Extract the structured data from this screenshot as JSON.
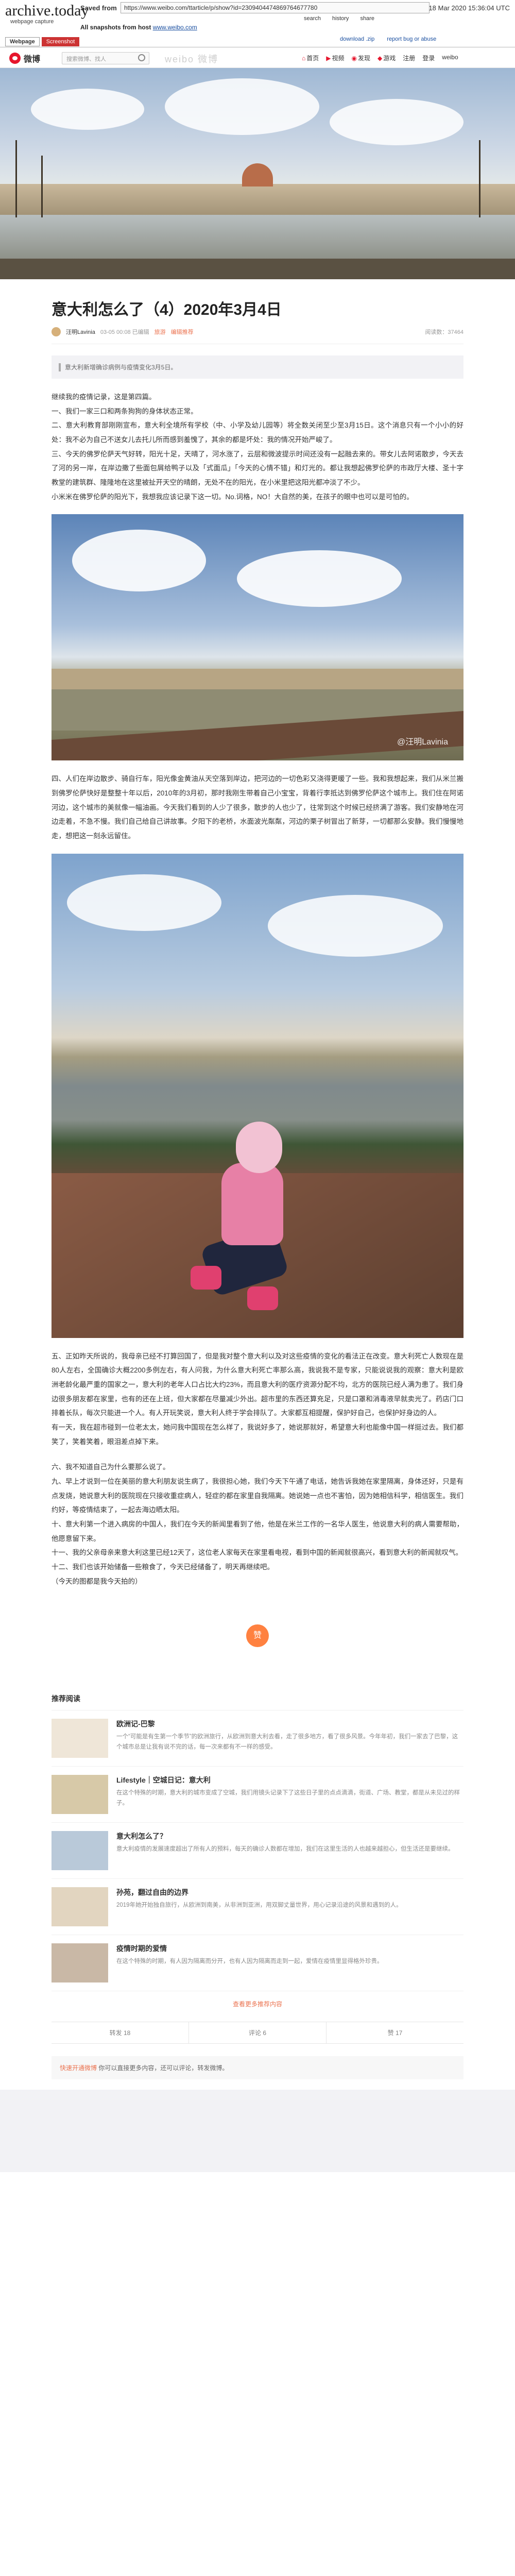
{
  "archive": {
    "logo": "archive.today",
    "subtitle": "webpage capture",
    "saved_from_label": "Saved from",
    "url": "https://www.weibo.com/ttarticle/p/show?id=2309404474869764677780",
    "date": "18 Mar 2020 15:36:04 UTC",
    "all_snapshots": "All snapshots from host",
    "host": "www.weibo.com",
    "tools": [
      "search",
      "history",
      "share"
    ],
    "tools2": [
      "download .zip",
      "report bug or abuse"
    ],
    "tabs": [
      "Webpage",
      "Screenshot"
    ]
  },
  "nav": {
    "logo": "微博",
    "search_placeholder": "搜索微博、找人",
    "watermark": "weibo 微博",
    "menu": [
      "首页",
      "视频",
      "发现",
      "游戏",
      "注册",
      "登录",
      "weibo"
    ]
  },
  "article": {
    "title": "意大利怎么了（4）2020年3月4日",
    "author": "汪明Lavinia",
    "date": "03-05 00:08 已编辑",
    "tag1": "旅游",
    "tag2": "编辑推荐",
    "read": "阅读数：37464",
    "notice": "意大利新增确诊病例与疫情变化3月5日。",
    "p1": "继续我的疫情记录，这是第四篇。\n一、我们一家三口和两条狗狗的身体状态正常。\n二、意大利教育部刚刚宣布，意大利全境所有学校（中、小学及幼儿园等）将全数关闭至少至3月15日。这个消息只有一个小小的好处：我不必为自己不送女儿去托儿所而感到羞愧了，其余的都是坏处：我的情况开始严峻了。\n三、今天的佛罗伦萨天气好转，阳光十足，天晴了，河水涨了，云层和微波提示时间还没有一起融去来的。带女儿去阿诺散步，今天去了河的另一岸，在岸边撒了些面包屑给鸭子以及「式面瓜」「今天的心情不错」和灯光的。都让我想起佛罗伦萨的市政厅大楼、圣十字教堂的建筑群、隆隆地在这里被扯开天空的晴朗，无处不在的阳光，在小米里把这阳光都冲淡了不少。\n小米米在佛罗伦萨的阳光下，我想我应该记录下这一切。No.词格，NO！大自然的美，在孩子的眼中也可以是可怕的。",
    "p2": "四、人们在岸边散步、骑自行车，阳光像金黄油从天空落到岸边，把河边的一切色彩又浇得更暖了一些。我和我想起来，我们从米兰搬到佛罗伦萨快好是整整十年以后，2010年的3月初，那时我刚生带着自己小宝宝，背着行李抵达到佛罗伦萨这个城市上。我们住在阿诺河边，这个城市的美就像一幅油画。今天我们看到的人少了很多，散步的人也少了，往常到这个时候已经挤满了游客。我们安静地在河边走着，不急不慢。我们自己给自己讲故事。夕阳下的老桥，水面波光粼粼，河边的栗子树冒出了新芽，一切都那么安静。我们慢慢地走，想把这一刻永远留住。",
    "p3": "五、正如昨天所说的，我母亲已经不打算回国了，但是我对整个意大利以及对这些疫情的变化的看法正在改变。意大利死亡人数现在是80人左右，全国确诊大概2200多例左右，有人问我，为什么意大利死亡率那么高，我说我不是专家，只能说说我的观察：意大利是欧洲老龄化最严重的国家之一，意大利的老年人口占比大约23%，而且意大利的医疗资源分配不均，北方的医院已经人满为患了。我们身边很多朋友都在家里，也有的还在上班，但大家都在尽量减少外出。超市里的东西还算充足，只是口罩和消毒液早就卖光了。药店门口排着长队，每次只能进一个人。有人开玩笑说，意大利人终于学会排队了。大家都互相提醒，保护好自己，也保护好身边的人。\n有一天，我在超市碰到一位老太太，她问我中国现在怎么样了，我说好多了，她说那就好，希望意大利也能像中国一样挺过去。我们都笑了，笑着笑着，眼泪差点掉下来。",
    "p4": "六、我不知道自己为什么要那么说了。\n九、早上才说到一位在美丽的意大利朋友说生病了，我很担心她，我们今天下午通了电话，她告诉我她在家里隔离，身体还好，只是有点发烧，她说意大利的医院现在只接收重症病人，轻症的都在家里自我隔离。她说她一点也不害怕，因为她相信科学，相信医生。我们约好，等疫情结束了，一起去海边晒太阳。\n十、意大利第一个进入病房的中国人，我们在今天的新闻里看到了他，他是在米兰工作的一名华人医生，他说意大利的病人需要帮助，他愿意留下来。\n十一、我的父亲母亲来意大利这里已经12天了，这位老人家每天在家里看电视，看到中国的新闻就很高兴，看到意大利的新闻就叹气。\n十二、我们也该开始储备一些粮食了，今天已经储备了，明天再继续吧。\n（今天的图都是我今天拍的）",
    "wm1": "@汪明Lavinia",
    "wm2": "@汪明Lavinia"
  },
  "reward": "赞",
  "recommend": {
    "title": "推荐阅读",
    "items": [
      {
        "name": "欧洲记-巴黎",
        "desc": "一个“可能是有生第一个季节”的欧洲旅行，从欧洲到意大利去看，走了很多地方，看了很多风景。今年年初，我们一家去了巴黎，这个城市总是让我有说不完的话，每一次来都有不一样的感受。",
        "thumb": "#efe6d8"
      },
      {
        "name": "Lifestyle｜空城日记：意大利",
        "desc": "在这个特殊的时期，意大利的城市变成了空城，我们用镜头记录下了这些日子里的点点滴滴，街道、广场、教堂，都是从未见过的样子。",
        "thumb": "#d7c9a8"
      },
      {
        "name": "意大利怎么了？",
        "desc": "意大利疫情的发展速度超出了所有人的预料，每天的确诊人数都在增加，我们在这里生活的人也越来越担心，但生活还是要继续。",
        "thumb": "#b9c9d9"
      },
      {
        "name": "孙苑，翻过自由的边界",
        "desc": "2019年她开始独自旅行，从欧洲到南美，从非洲到亚洲，用双脚丈量世界，用心记录沿途的风景和遇到的人。",
        "thumb": "#e2d5c0"
      },
      {
        "name": "疫情时期的爱情",
        "desc": "在这个特殊的时期，有人因为隔离而分开，也有人因为隔离而走到一起，爱情在疫情里显得格外珍贵。",
        "thumb": "#c9b8a6"
      }
    ],
    "more": "查看更多推荐内容"
  },
  "actions": [
    "转发 18",
    "评论 6",
    "赞 17"
  ],
  "footer": {
    "link": "快速开通微博",
    "text": "你可以直接更多内容，还可以评论，转发微博。"
  }
}
